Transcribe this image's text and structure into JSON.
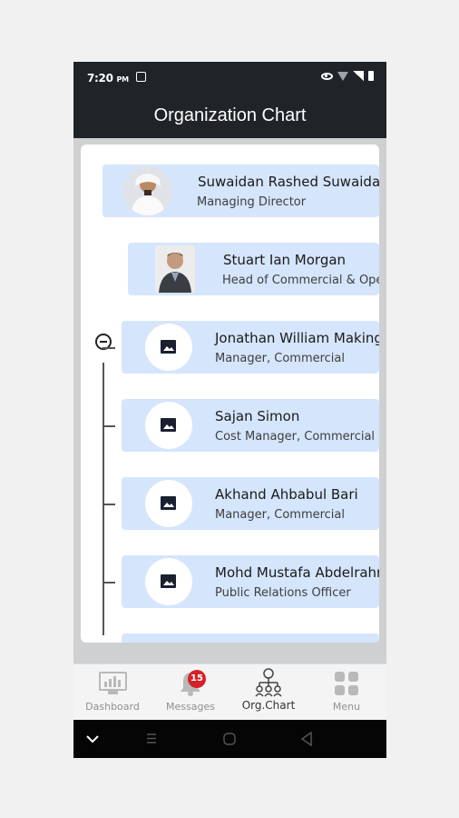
{
  "status_bar": {
    "time": "7:20",
    "ampm": "PM"
  },
  "header": {
    "title": "Organization Chart"
  },
  "org": {
    "root": {
      "name": "Suwaidan Rashed Suwaidan",
      "role": "Managing Director"
    },
    "head": {
      "name": "Stuart Ian Morgan",
      "role": "Head of Commercial & Operations"
    },
    "members": [
      {
        "name": "Jonathan William Making",
        "role": "Manager, Commercial"
      },
      {
        "name": "Sajan Simon",
        "role": "Cost Manager, Commercial"
      },
      {
        "name": "Akhand Ahbabul Bari",
        "role": "Manager, Commercial"
      },
      {
        "name": "Mohd Mustafa Abdelrahman",
        "role": "Public Relations Officer"
      }
    ]
  },
  "bottom_nav": {
    "items": [
      {
        "label": "Dashboard",
        "icon": "dashboard-icon"
      },
      {
        "label": "Messages",
        "icon": "bell-icon",
        "badge": "15"
      },
      {
        "label": "Org.Chart",
        "icon": "org-chart-icon"
      },
      {
        "label": "Menu",
        "icon": "grid-icon"
      }
    ]
  },
  "colors": {
    "header_bg": "#202429",
    "node_bg": "#d5e5fc",
    "badge_bg": "#d32228"
  }
}
